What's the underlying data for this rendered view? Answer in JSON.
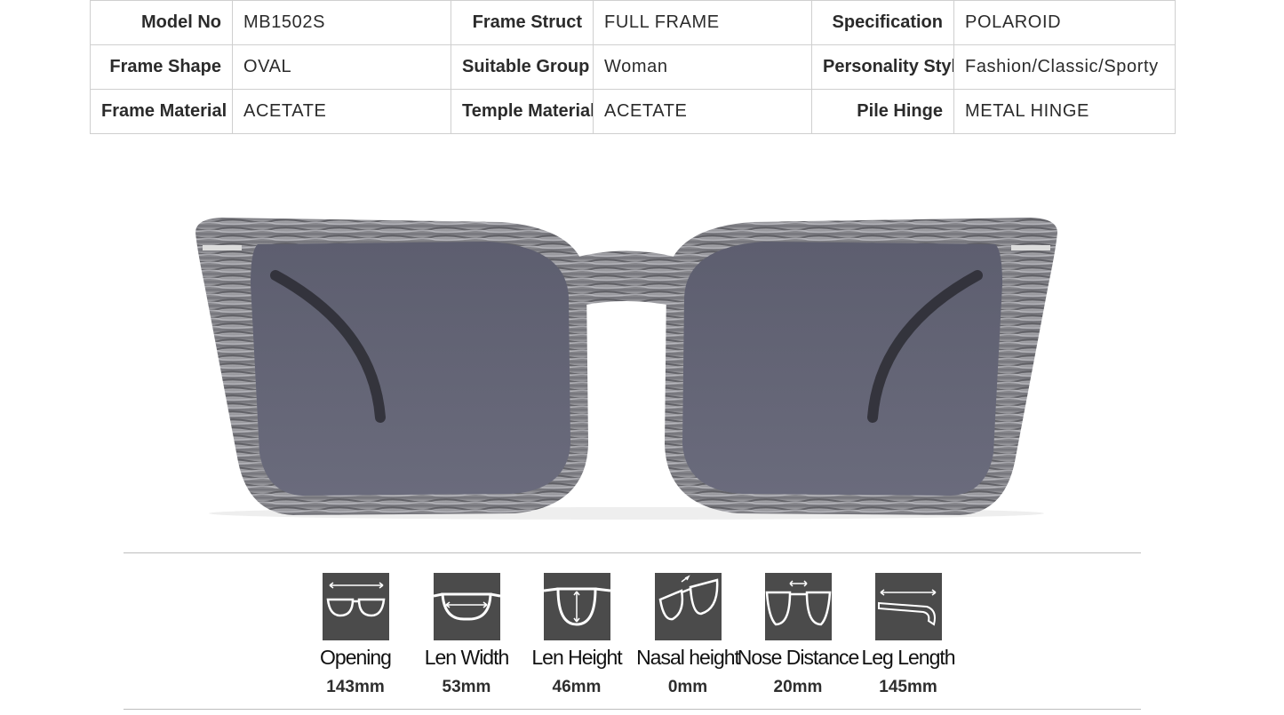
{
  "specs": {
    "rows": [
      [
        {
          "label": "Model No",
          "value": "MB1502S"
        },
        {
          "label": "Frame Struct",
          "value": "FULL FRAME"
        },
        {
          "label": "Specification",
          "value": "POLAROID"
        }
      ],
      [
        {
          "label": "Frame Shape",
          "value": "OVAL"
        },
        {
          "label": "Suitable Group",
          "value": "Woman"
        },
        {
          "label": "Personality Style",
          "value": "Fashion/Classic/Sporty"
        }
      ],
      [
        {
          "label": "Frame Material",
          "value": "ACETATE"
        },
        {
          "label": "Temple Material",
          "value": "ACETATE"
        },
        {
          "label": "Pile Hinge",
          "value": "METAL HINGE"
        }
      ]
    ]
  },
  "product": {
    "frame_color": "#8a8a90",
    "lens_color": "#5f6072"
  },
  "dimensions": [
    {
      "icon": "opening-icon",
      "label": "Opening",
      "value": "143mm"
    },
    {
      "icon": "lens-width-icon",
      "label": "Len Width",
      "value": "53mm"
    },
    {
      "icon": "lens-height-icon",
      "label": "Len Height",
      "value": "46mm"
    },
    {
      "icon": "nasal-height-icon",
      "label": "Nasal height",
      "value": "0mm"
    },
    {
      "icon": "nose-distance-icon",
      "label": "Nose Distance",
      "value": "20mm"
    },
    {
      "icon": "leg-length-icon",
      "label": "Leg Length",
      "value": "145mm"
    }
  ]
}
